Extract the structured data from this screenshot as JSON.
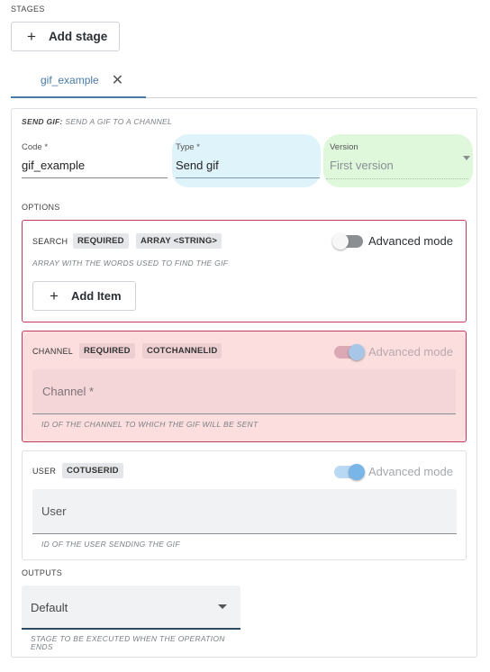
{
  "stages": {
    "section_label": "STAGES",
    "add_stage_label": "Add stage"
  },
  "tabs": [
    {
      "label": "gif_example"
    }
  ],
  "stage": {
    "description_prefix": "SEND GIF:",
    "description": "SEND A GIF TO A CHANNEL",
    "code": {
      "label": "Code *",
      "value": "gif_example"
    },
    "type": {
      "label": "Type *",
      "value": "Send gif"
    },
    "version": {
      "label": "Version",
      "value": "First version"
    },
    "options_label": "OPTIONS",
    "options": [
      {
        "name": "SEARCH",
        "tags": [
          "REQUIRED",
          "ARRAY <STRING>"
        ],
        "advanced_label": "Advanced mode",
        "advanced_on": false,
        "help": "ARRAY WITH THE WORDS USED TO FIND THE GIF",
        "add_item_label": "Add Item"
      },
      {
        "name": "CHANNEL",
        "tags": [
          "REQUIRED",
          "COTCHANNELID"
        ],
        "advanced_label": "Advanced mode",
        "advanced_on": true,
        "input_placeholder": "Channel *",
        "help": "ID OF THE CHANNEL TO WHICH THE GIF WILL BE SENT"
      },
      {
        "name": "USER",
        "tags": [
          "COTUSERID"
        ],
        "advanced_label": "Advanced mode",
        "advanced_on": true,
        "input_placeholder": "User",
        "help": "ID OF THE USER SENDING THE GIF"
      }
    ],
    "outputs_label": "OUTPUTS",
    "output_select": {
      "value": "Default"
    },
    "output_help": "STAGE TO BE EXECUTED WHEN THE OPERATION ENDS"
  },
  "colors": {
    "accent": "#4a7ba6",
    "type_highlight": "#dff3fb",
    "version_highlight": "#dff8dc",
    "error_border": "#c23a5d",
    "error_fill": "#fde3e3",
    "toggle_on": "#7ab5e8"
  },
  "icons": {
    "add": "plus-icon",
    "close": "close-icon",
    "dropdown": "caret-down-icon"
  }
}
